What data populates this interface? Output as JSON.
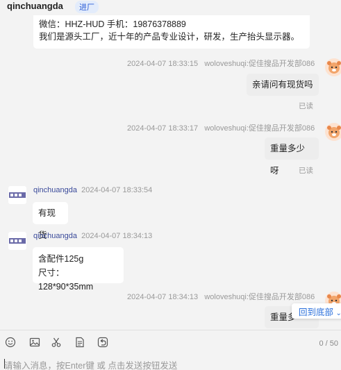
{
  "header": {
    "name": "qinchuangda",
    "badge": "进厂"
  },
  "messages": [
    {
      "side": "left",
      "lines": [
        "微信：HHZ-HUD   手机：19876378889",
        "我们是源头工厂，近十年的产品专业设计，研发，生产抬头显示器。"
      ]
    },
    {
      "side": "right",
      "time": "2024-04-07 18:33:15",
      "author": "woloveshuqi:促佳搜品开发部086",
      "text": "亲请问有现货吗",
      "status": "已读"
    },
    {
      "side": "right",
      "time": "2024-04-07 18:33:17",
      "author": "woloveshuqi:促佳搜品开发部086",
      "text": "重量多少呀",
      "status": "已读"
    },
    {
      "side": "left",
      "author": "qinchuangda",
      "time": "2024-04-07 18:33:54",
      "text": "有现货"
    },
    {
      "side": "left",
      "author": "qinchuangda",
      "time": "2024-04-07 18:34:13",
      "lines": [
        "含配件125g",
        "尺寸：128*90*35mm"
      ]
    },
    {
      "side": "right",
      "time": "2024-04-07 18:34:13",
      "author": "woloveshuqi:促佳搜品开发部086",
      "text": "重量多"
    }
  ],
  "back_to_bottom": "回到底部",
  "toolbar": {
    "icons": [
      "smile-icon",
      "image-icon",
      "scissors-icon",
      "document-icon",
      "history-icon"
    ],
    "counter": "0 / 50",
    "placeholder": "请输入消息，按Enter键 或 点击发送按钮发送"
  },
  "colors": {
    "author_left": "#3a4a9a",
    "link_blue": "#2a6fdb",
    "badge_bg": "#e3ecfb"
  }
}
